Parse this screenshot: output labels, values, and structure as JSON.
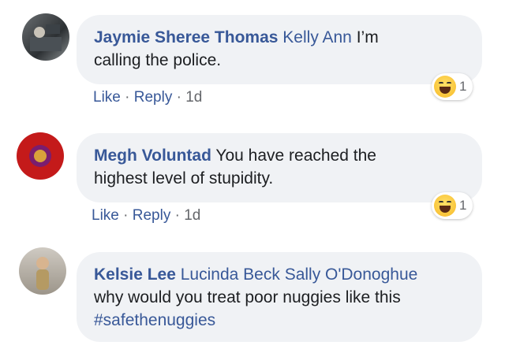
{
  "comments": [
    {
      "author": "Jaymie Sheree Thomas",
      "mention": "Kelly Ann",
      "text_line1": " I’m",
      "text_line2": "calling the police.",
      "like": "Like",
      "reply": "Reply",
      "sep": "·",
      "time": "1d",
      "reaction_count": "1",
      "reaction_icon": "haha-reaction-icon"
    },
    {
      "author": "Megh Voluntad",
      "text_line1": " You have reached the",
      "text_line2": "highest level of stupidity.",
      "like": "Like",
      "reply": "Reply",
      "sep": "·",
      "time": "1d",
      "reaction_count": "1",
      "reaction_icon": "haha-reaction-icon"
    },
    {
      "author": "Kelsie Lee",
      "mention1": "Lucinda Beck",
      "mention2": "Sally O'Donoghue",
      "text_line2": "why would you treat poor nuggies like this",
      "hashtag": "#safethenuggies"
    }
  ],
  "colors": {
    "link": "#385898",
    "bubble": "#f0f2f5",
    "text": "#1c1e21",
    "muted": "#65676b"
  }
}
